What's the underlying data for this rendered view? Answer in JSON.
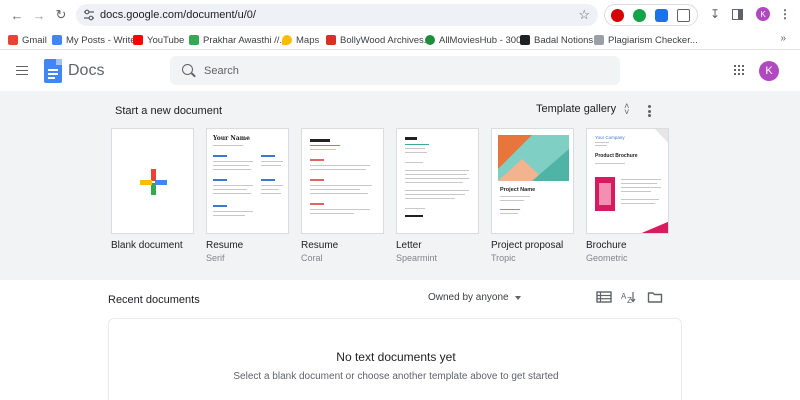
{
  "browser": {
    "url": "docs.google.com/document/u/0/",
    "profile_initial": "K",
    "bookmarks": [
      {
        "label": "Gmail",
        "icon": "gmail-icon",
        "color": "#ea4335"
      },
      {
        "label": "My Posts - Write",
        "icon": "post-icon",
        "color": "#4285f4"
      },
      {
        "label": "YouTube",
        "icon": "youtube-icon",
        "color": "#ff0000"
      },
      {
        "label": "Prakhar Awasthi //...",
        "icon": "grid-icon",
        "color": "#34a853"
      },
      {
        "label": "Maps",
        "icon": "maps-icon",
        "color": "#fbbc04"
      },
      {
        "label": "BollyWood Archives...",
        "icon": "hd-icon",
        "color": "#d93025"
      },
      {
        "label": "AllMoviesHub - 300...",
        "icon": "globe-icon",
        "color": "#1e8e3e"
      },
      {
        "label": "Badal Notions",
        "icon": "notion-icon",
        "color": "#202124"
      },
      {
        "label": "Plagiarism Checker...",
        "icon": "sst-icon",
        "color": "#9aa0a6"
      }
    ]
  },
  "header": {
    "app_name": "Docs",
    "search_placeholder": "Search",
    "profile_initial": "K"
  },
  "templates_section": {
    "title": "Start a new document",
    "gallery_label": "Template gallery",
    "templates": [
      {
        "name": "Blank document",
        "subtitle": ""
      },
      {
        "name": "Resume",
        "subtitle": "Serif"
      },
      {
        "name": "Resume",
        "subtitle": "Coral"
      },
      {
        "name": "Letter",
        "subtitle": "Spearmint"
      },
      {
        "name": "Project proposal",
        "subtitle": "Tropic"
      },
      {
        "name": "Brochure",
        "subtitle": "Geometric"
      }
    ],
    "thumb_text": {
      "resume_serif_name": "Your Name",
      "proposal_title": "Project Name",
      "brochure_company": "Your Company",
      "brochure_title": "Product Brochure"
    }
  },
  "recent": {
    "title": "Recent documents",
    "owner_filter": "Owned by anyone",
    "empty_title": "No text documents yet",
    "empty_subtitle": "Select a blank document or choose another template above to get started"
  },
  "colors": {
    "accent_blue": "#4285f4",
    "coral": "#e06666",
    "spearmint": "#3aa89b",
    "tropic_teal": "#7fcfc5",
    "tropic_orange": "#e8763c",
    "geometric_pink": "#d81b60"
  }
}
